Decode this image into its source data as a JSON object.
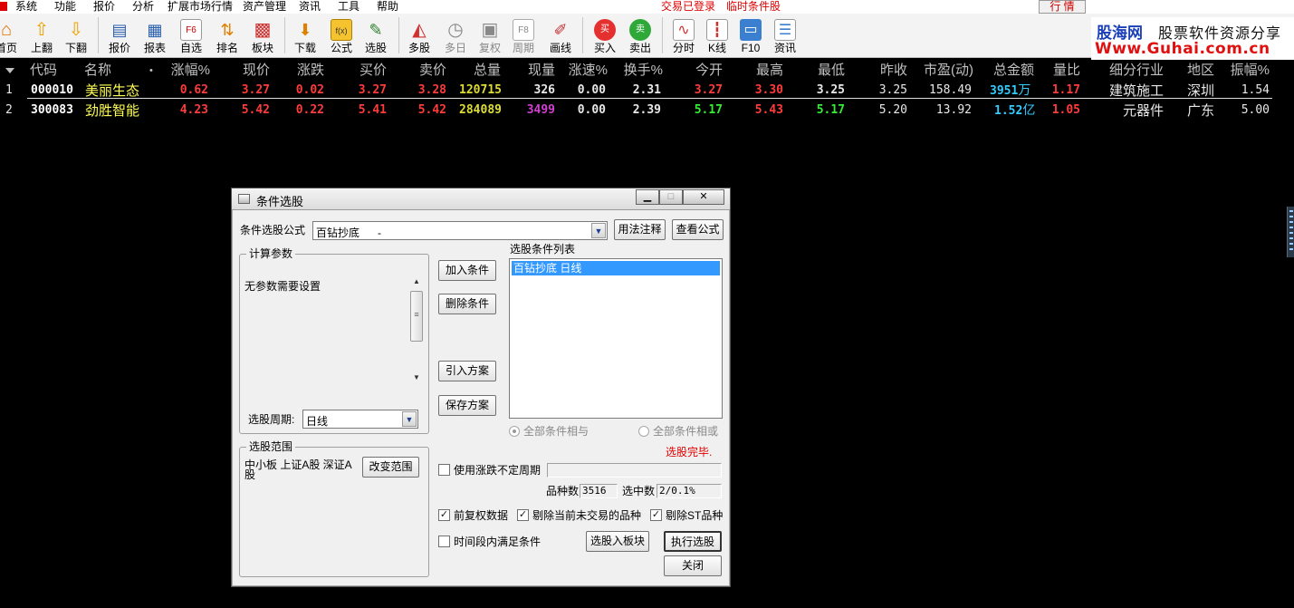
{
  "menu": {
    "items": [
      "系统",
      "功能",
      "报价",
      "分析",
      "扩展市场行情",
      "资产管理",
      "资讯",
      "工具",
      "帮助"
    ],
    "status_login": "交易已登录",
    "status_cond": "临时条件股",
    "mode_button": "行 情"
  },
  "toolbar": {
    "buttons": [
      {
        "label": "首页",
        "icon": "home-icon",
        "glyph": "⌂"
      },
      {
        "label": "上翻",
        "icon": "page-up-icon",
        "glyph": "⇧"
      },
      {
        "label": "下翻",
        "icon": "page-down-icon",
        "glyph": "⇩"
      },
      {
        "label": "报价",
        "icon": "quote-icon",
        "glyph": "▤"
      },
      {
        "label": "报表",
        "icon": "report-icon",
        "glyph": "▦"
      },
      {
        "label": "自选",
        "icon": "watchlist-icon",
        "glyph": "F6"
      },
      {
        "label": "排名",
        "icon": "ranking-icon",
        "glyph": "⇅"
      },
      {
        "label": "板块",
        "icon": "sector-icon",
        "glyph": "▩"
      },
      {
        "label": "下载",
        "icon": "download-icon",
        "glyph": "⬇"
      },
      {
        "label": "公式",
        "icon": "formula-icon",
        "glyph": "f(x)"
      },
      {
        "label": "选股",
        "icon": "stock-picker-icon",
        "glyph": "✎"
      },
      {
        "label": "多股",
        "icon": "multi-stock-icon",
        "glyph": "◭"
      },
      {
        "label": "多日",
        "icon": "multi-day-icon",
        "glyph": "◷"
      },
      {
        "label": "复权",
        "icon": "adjust-icon",
        "glyph": "▣"
      },
      {
        "label": "周期",
        "icon": "period-icon",
        "glyph": "F8"
      },
      {
        "label": "画线",
        "icon": "draw-line-icon",
        "glyph": "✐"
      },
      {
        "label": "买入",
        "icon": "buy-icon",
        "glyph": "买"
      },
      {
        "label": "卖出",
        "icon": "sell-icon",
        "glyph": "卖"
      },
      {
        "label": "分时",
        "icon": "intraday-icon",
        "glyph": "∿"
      },
      {
        "label": "K线",
        "icon": "kline-icon",
        "glyph": "┇"
      },
      {
        "label": "F10",
        "icon": "f10-icon",
        "glyph": "▭"
      },
      {
        "label": "资讯",
        "icon": "news-icon",
        "glyph": "☰"
      }
    ]
  },
  "logo": {
    "cn": "股海网",
    "tagline": "股票软件资源分享",
    "url": "Www.Guhai.com.cn"
  },
  "table": {
    "columns": [
      "代码",
      "名称",
      "•",
      "涨幅%",
      "现价",
      "涨跌",
      "买价",
      "卖价",
      "总量",
      "现量",
      "涨速%",
      "换手%",
      "今开",
      "最高",
      "最低",
      "昨收",
      "市盈(动)",
      "总金额",
      "量比",
      "细分行业",
      "地区",
      "振幅%"
    ],
    "rows": [
      {
        "idx": "1",
        "code": "000010",
        "name": "美丽生态",
        "pct": "0.62",
        "price": "3.27",
        "chg": "0.02",
        "bid": "3.27",
        "ask": "3.28",
        "vol": "120715",
        "cur": "326",
        "speed": "0.00",
        "turnover": "2.31",
        "open": "3.27",
        "high": "3.30",
        "low": "3.25",
        "prev": "3.25",
        "pe": "158.49",
        "amount_num": "3951",
        "amount_unit": "万",
        "ratio": "1.17",
        "industry": "建筑施工",
        "region": "深圳",
        "amp": "1.54"
      },
      {
        "idx": "2",
        "code": "300083",
        "name": "劲胜智能",
        "pct": "4.23",
        "price": "5.42",
        "chg": "0.22",
        "bid": "5.41",
        "ask": "5.42",
        "vol": "284089",
        "cur": "3499",
        "speed": "0.00",
        "turnover": "2.39",
        "open": "5.17",
        "high": "5.43",
        "low": "5.17",
        "prev": "5.20",
        "pe": "13.92",
        "amount_num": "1.52",
        "amount_unit": "亿",
        "ratio": "1.05",
        "industry": "元器件",
        "region": "广东",
        "amp": "5.00"
      }
    ],
    "colors": {
      "up": "#ff3b3b",
      "down": "#33ee33",
      "flat": "#e8e8e8",
      "code": "#ffffff",
      "name": "#ffff55",
      "vol": "#dddd33",
      "cur_big": "#d040d0",
      "amount": "#33ccff",
      "header": "#c0c0c0"
    }
  },
  "dialog": {
    "title": "条件选股",
    "min_btn": "▁",
    "max_btn": "□",
    "close_btn": "✕",
    "formula_label": "条件选股公式",
    "formula_value": "百钻抄底      -",
    "usage_btn": "用法注释",
    "view_formula_btn": "查看公式",
    "params_group": "计算参数",
    "params_text": "无参数需要设置",
    "period_label": "选股周期:",
    "period_value": "日线",
    "add_btn": "加入条件",
    "delete_btn": "删除条件",
    "import_btn": "引入方案",
    "save_btn": "保存方案",
    "cond_list_label": "选股条件列表",
    "cond_list": [
      "百钻抄底  日线"
    ],
    "radio_and": "全部条件相与",
    "radio_or": "全部条件相或",
    "status": "选股完毕.",
    "range_group": "选股范围",
    "range_text": "中小板 上证A股 深证A股",
    "change_range_btn": "改变范围",
    "uncertain_period_label": "使用涨跌不定周期",
    "variety_label": "品种数",
    "variety_value": "3516",
    "selected_label": "选中数",
    "selected_value": "2/0.1%",
    "adj_label": "前复权数据",
    "exclude_untraded_label": "剔除当前未交易的品种",
    "exclude_st_label": "剔除ST品种",
    "time_range_label": "时间段内满足条件",
    "to_block_btn": "选股入板块",
    "execute_btn": "执行选股",
    "close_label": "关闭",
    "status_color": "#e00000"
  }
}
